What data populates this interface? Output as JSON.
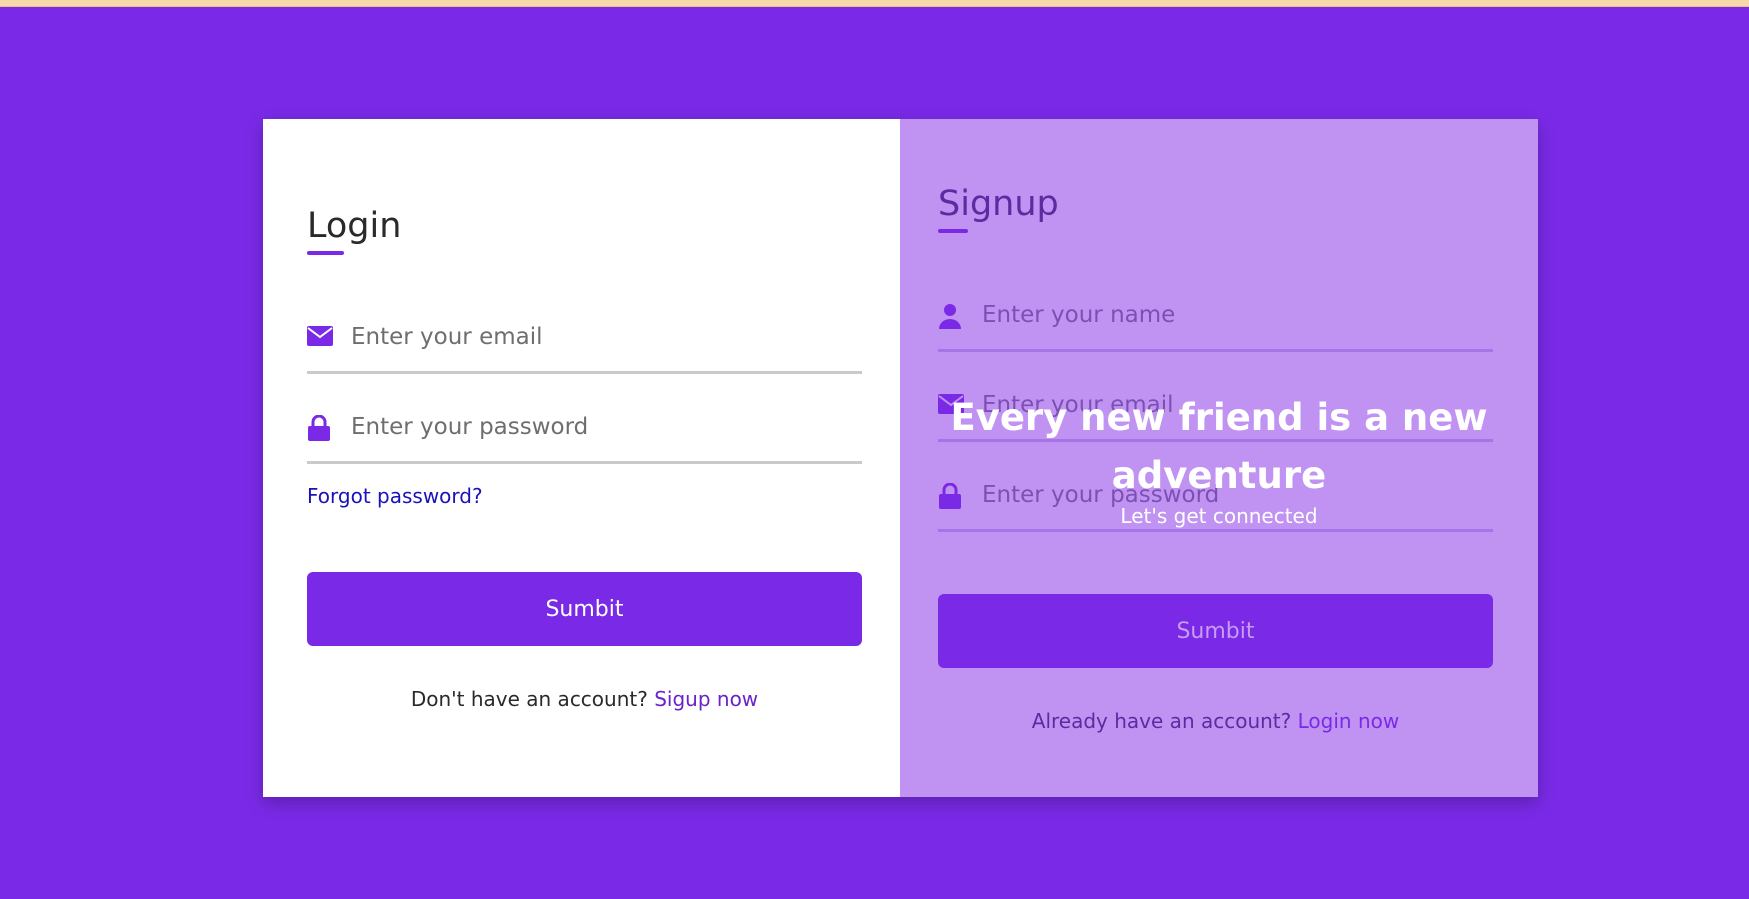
{
  "colors": {
    "background": "#7a2ae7",
    "accent": "#7a2ae7",
    "login_panel": "#ffffff",
    "signup_panel": "#c093f3",
    "forgot_link": "#1a12b8"
  },
  "login": {
    "title": "Login",
    "email_placeholder": "Enter your email",
    "email_icon": "envelope-icon",
    "password_placeholder": "Enter your password",
    "password_icon": "lock-icon",
    "forgot_label": "Forgot password?",
    "submit_label": "Sumbit",
    "switch_text": "Don't have an account?",
    "switch_link": "Sigup now"
  },
  "signup": {
    "title": "Signup",
    "name_placeholder": "Enter your name",
    "name_icon": "user-icon",
    "email_placeholder": "Enter your email",
    "email_icon": "envelope-icon",
    "password_placeholder": "Enter your password",
    "password_icon": "lock-icon",
    "submit_label": "Sumbit",
    "switch_text": "Already have an account?",
    "switch_link": "Login now"
  },
  "overlay": {
    "headline": "Every new friend is a new adventure",
    "subtext": "Let's get connected"
  }
}
